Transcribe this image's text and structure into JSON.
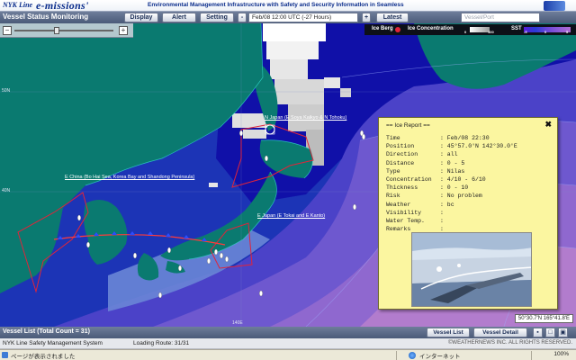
{
  "banner": {
    "nyk": "NYK Line",
    "emissions": "e-missions'",
    "tagline": "Environmental Management Infrastructure with Safety and Security InformatIon in Seamless"
  },
  "toolbar": {
    "title": "Vessel Status Monitoring",
    "display": "Display",
    "alert": "Alert",
    "setting": "Setting",
    "prev": "-",
    "time": "Feb/08 12:00 UTC (-27 Hours)",
    "next": "+",
    "latest": "Latest",
    "search_placeholder": "Vessel/Port"
  },
  "legend": {
    "ice_berg": "Ice Berg",
    "ice_conc": "Ice Concentration",
    "ice_min": "0",
    "ice_max": "100",
    "sst": "SST",
    "sst_min": "-5",
    "sst_mid": "0",
    "sst_max": "5",
    "colors": [
      "#ffffff",
      "#e8e8e8",
      "#cfcfcf",
      "#b5b5b5",
      "#9a9a9a"
    ],
    "sst_colors": [
      "#5a1ad8",
      "#2b3bd5",
      "#6b45d8",
      "#8e5bd6",
      "#b06bd3"
    ]
  },
  "map": {
    "labels": {
      "n_japan": "N Japan (E Soya Kaikyo & N Tohoku)",
      "e_china": "E China (Bo Hai Sea, Korea Bay and Shandong Peninsula)",
      "e_japan": "E Japan (E Tokai and E Kanto)"
    },
    "lat": {
      "l50": "50N",
      "l40": "40N",
      "lon140": "140E"
    }
  },
  "report": {
    "title": "== Ice Report ==",
    "rows": [
      {
        "k": "Time",
        "v": ": Feb/08 22:30"
      },
      {
        "k": "Position",
        "v": ": 45°57.0'N 142°30.0'E"
      },
      {
        "k": "Direction",
        "v": ": all"
      },
      {
        "k": "Distance",
        "v": ": 0 - 5"
      },
      {
        "k": "Type",
        "v": ": Nilas"
      },
      {
        "k": "Concentration",
        "v": ": 4/10 - 6/10"
      },
      {
        "k": "Thickness",
        "v": ": 0 - 10"
      },
      {
        "k": "Risk",
        "v": ": No problem"
      },
      {
        "k": "Weather",
        "v": ": bc"
      },
      {
        "k": "Visibility",
        "v": ":"
      },
      {
        "k": "Water Temp.",
        "v": ":"
      },
      {
        "k": "Remarks",
        "v": ":"
      }
    ]
  },
  "coords": "50°30.7'N 165°41.8'E",
  "vessel_bar": {
    "title": "Vessel List (Total Count = 31)",
    "vessel_list": "Vessel List",
    "vessel_detail": "Vessel Detail"
  },
  "status": {
    "system": "NYK Line Safety Management System",
    "loading": "Loading Route: 31/31",
    "copyright": "©WEATHERNEWS INC. ALL RIGHTS RESERVED."
  },
  "browser": {
    "page": "ページが表示されました",
    "zone": "インターネット",
    "zoom": "100%"
  }
}
